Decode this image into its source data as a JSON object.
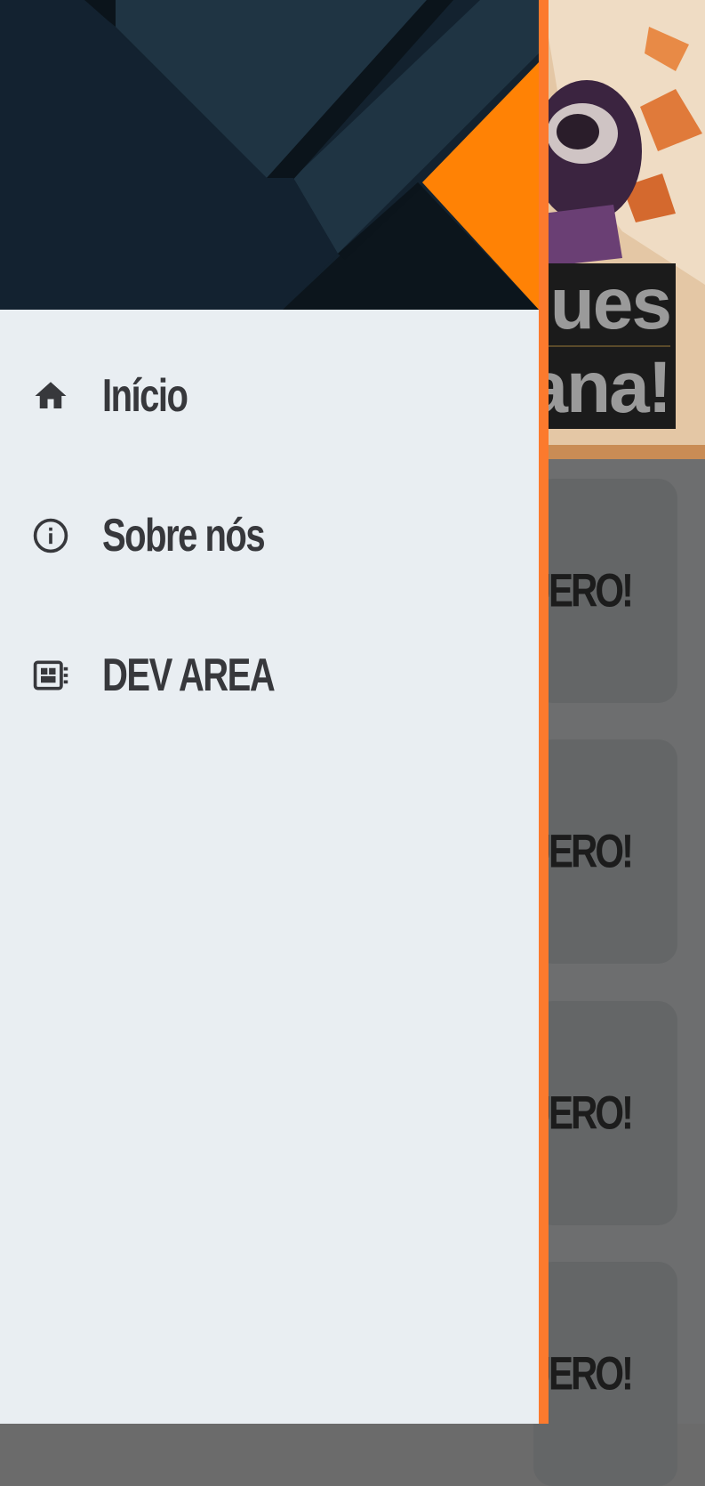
{
  "background": {
    "hero": {
      "title_line1": "ques",
      "title_line2": "ana!"
    },
    "cards": [
      {
        "cta": "UERO!"
      },
      {
        "cta": "UERO!"
      },
      {
        "cta": "UERO!"
      },
      {
        "cta": "UERO!"
      }
    ]
  },
  "drawer": {
    "accent_color": "#fc7a2d",
    "header_color": "#13222f",
    "items": [
      {
        "label": "Início",
        "icon": "home-icon"
      },
      {
        "label": "Sobre nós",
        "icon": "info-icon"
      },
      {
        "label": "DEV AREA",
        "icon": "dashboard-icon"
      }
    ]
  }
}
